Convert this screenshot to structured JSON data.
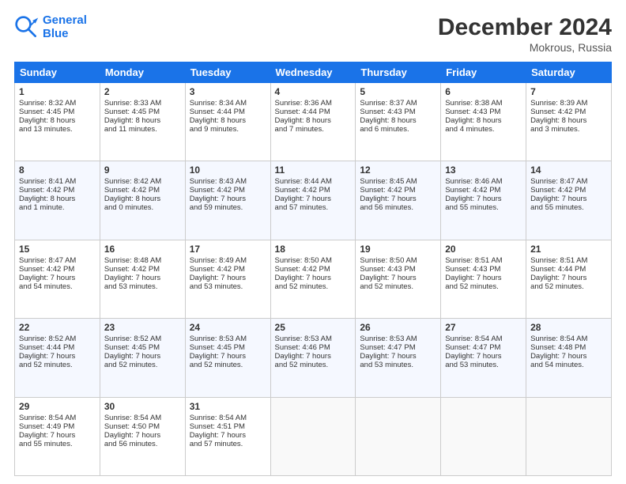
{
  "header": {
    "logo_line1": "General",
    "logo_line2": "Blue",
    "month": "December 2024",
    "location": "Mokrous, Russia"
  },
  "weekdays": [
    "Sunday",
    "Monday",
    "Tuesday",
    "Wednesday",
    "Thursday",
    "Friday",
    "Saturday"
  ],
  "weeks": [
    [
      {
        "day": "1",
        "lines": [
          "Sunrise: 8:32 AM",
          "Sunset: 4:45 PM",
          "Daylight: 8 hours",
          "and 13 minutes."
        ]
      },
      {
        "day": "2",
        "lines": [
          "Sunrise: 8:33 AM",
          "Sunset: 4:45 PM",
          "Daylight: 8 hours",
          "and 11 minutes."
        ]
      },
      {
        "day": "3",
        "lines": [
          "Sunrise: 8:34 AM",
          "Sunset: 4:44 PM",
          "Daylight: 8 hours",
          "and 9 minutes."
        ]
      },
      {
        "day": "4",
        "lines": [
          "Sunrise: 8:36 AM",
          "Sunset: 4:44 PM",
          "Daylight: 8 hours",
          "and 7 minutes."
        ]
      },
      {
        "day": "5",
        "lines": [
          "Sunrise: 8:37 AM",
          "Sunset: 4:43 PM",
          "Daylight: 8 hours",
          "and 6 minutes."
        ]
      },
      {
        "day": "6",
        "lines": [
          "Sunrise: 8:38 AM",
          "Sunset: 4:43 PM",
          "Daylight: 8 hours",
          "and 4 minutes."
        ]
      },
      {
        "day": "7",
        "lines": [
          "Sunrise: 8:39 AM",
          "Sunset: 4:42 PM",
          "Daylight: 8 hours",
          "and 3 minutes."
        ]
      }
    ],
    [
      {
        "day": "8",
        "lines": [
          "Sunrise: 8:41 AM",
          "Sunset: 4:42 PM",
          "Daylight: 8 hours",
          "and 1 minute."
        ]
      },
      {
        "day": "9",
        "lines": [
          "Sunrise: 8:42 AM",
          "Sunset: 4:42 PM",
          "Daylight: 8 hours",
          "and 0 minutes."
        ]
      },
      {
        "day": "10",
        "lines": [
          "Sunrise: 8:43 AM",
          "Sunset: 4:42 PM",
          "Daylight: 7 hours",
          "and 59 minutes."
        ]
      },
      {
        "day": "11",
        "lines": [
          "Sunrise: 8:44 AM",
          "Sunset: 4:42 PM",
          "Daylight: 7 hours",
          "and 57 minutes."
        ]
      },
      {
        "day": "12",
        "lines": [
          "Sunrise: 8:45 AM",
          "Sunset: 4:42 PM",
          "Daylight: 7 hours",
          "and 56 minutes."
        ]
      },
      {
        "day": "13",
        "lines": [
          "Sunrise: 8:46 AM",
          "Sunset: 4:42 PM",
          "Daylight: 7 hours",
          "and 55 minutes."
        ]
      },
      {
        "day": "14",
        "lines": [
          "Sunrise: 8:47 AM",
          "Sunset: 4:42 PM",
          "Daylight: 7 hours",
          "and 55 minutes."
        ]
      }
    ],
    [
      {
        "day": "15",
        "lines": [
          "Sunrise: 8:47 AM",
          "Sunset: 4:42 PM",
          "Daylight: 7 hours",
          "and 54 minutes."
        ]
      },
      {
        "day": "16",
        "lines": [
          "Sunrise: 8:48 AM",
          "Sunset: 4:42 PM",
          "Daylight: 7 hours",
          "and 53 minutes."
        ]
      },
      {
        "day": "17",
        "lines": [
          "Sunrise: 8:49 AM",
          "Sunset: 4:42 PM",
          "Daylight: 7 hours",
          "and 53 minutes."
        ]
      },
      {
        "day": "18",
        "lines": [
          "Sunrise: 8:50 AM",
          "Sunset: 4:42 PM",
          "Daylight: 7 hours",
          "and 52 minutes."
        ]
      },
      {
        "day": "19",
        "lines": [
          "Sunrise: 8:50 AM",
          "Sunset: 4:43 PM",
          "Daylight: 7 hours",
          "and 52 minutes."
        ]
      },
      {
        "day": "20",
        "lines": [
          "Sunrise: 8:51 AM",
          "Sunset: 4:43 PM",
          "Daylight: 7 hours",
          "and 52 minutes."
        ]
      },
      {
        "day": "21",
        "lines": [
          "Sunrise: 8:51 AM",
          "Sunset: 4:44 PM",
          "Daylight: 7 hours",
          "and 52 minutes."
        ]
      }
    ],
    [
      {
        "day": "22",
        "lines": [
          "Sunrise: 8:52 AM",
          "Sunset: 4:44 PM",
          "Daylight: 7 hours",
          "and 52 minutes."
        ]
      },
      {
        "day": "23",
        "lines": [
          "Sunrise: 8:52 AM",
          "Sunset: 4:45 PM",
          "Daylight: 7 hours",
          "and 52 minutes."
        ]
      },
      {
        "day": "24",
        "lines": [
          "Sunrise: 8:53 AM",
          "Sunset: 4:45 PM",
          "Daylight: 7 hours",
          "and 52 minutes."
        ]
      },
      {
        "day": "25",
        "lines": [
          "Sunrise: 8:53 AM",
          "Sunset: 4:46 PM",
          "Daylight: 7 hours",
          "and 52 minutes."
        ]
      },
      {
        "day": "26",
        "lines": [
          "Sunrise: 8:53 AM",
          "Sunset: 4:47 PM",
          "Daylight: 7 hours",
          "and 53 minutes."
        ]
      },
      {
        "day": "27",
        "lines": [
          "Sunrise: 8:54 AM",
          "Sunset: 4:47 PM",
          "Daylight: 7 hours",
          "and 53 minutes."
        ]
      },
      {
        "day": "28",
        "lines": [
          "Sunrise: 8:54 AM",
          "Sunset: 4:48 PM",
          "Daylight: 7 hours",
          "and 54 minutes."
        ]
      }
    ],
    [
      {
        "day": "29",
        "lines": [
          "Sunrise: 8:54 AM",
          "Sunset: 4:49 PM",
          "Daylight: 7 hours",
          "and 55 minutes."
        ]
      },
      {
        "day": "30",
        "lines": [
          "Sunrise: 8:54 AM",
          "Sunset: 4:50 PM",
          "Daylight: 7 hours",
          "and 56 minutes."
        ]
      },
      {
        "day": "31",
        "lines": [
          "Sunrise: 8:54 AM",
          "Sunset: 4:51 PM",
          "Daylight: 7 hours",
          "and 57 minutes."
        ]
      },
      null,
      null,
      null,
      null
    ]
  ]
}
